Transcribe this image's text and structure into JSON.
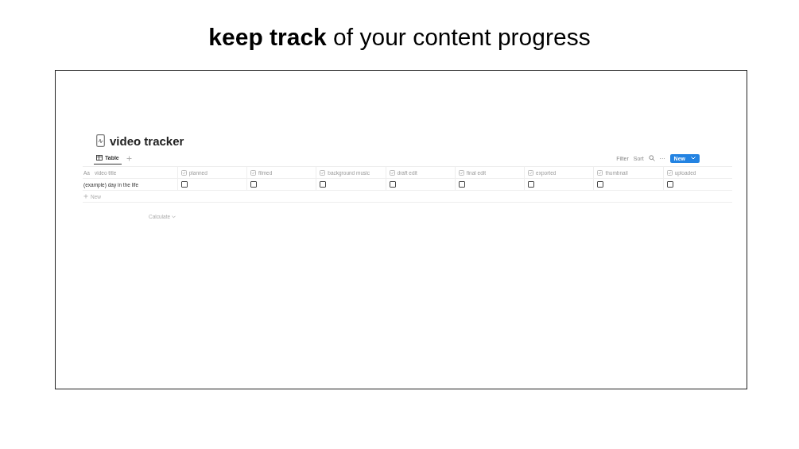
{
  "headline": "**keep track** of your content progress",
  "page": {
    "title": "video tracker"
  },
  "views": [
    {
      "label": "Table",
      "selected": true
    }
  ],
  "toolbar": {
    "filter": "Filter",
    "sort": "Sort",
    "more": "···",
    "new_button": "New"
  },
  "table": {
    "title_column": {
      "icon": "Aa",
      "label": "video title"
    },
    "columns": [
      {
        "label": "planned"
      },
      {
        "label": "filmed"
      },
      {
        "label": "background music"
      },
      {
        "label": "draft edit"
      },
      {
        "label": "final edit"
      },
      {
        "label": "exported"
      },
      {
        "label": "thumbnail"
      },
      {
        "label": "uploaded"
      }
    ],
    "rows": [
      {
        "title": "(example) day in the life",
        "values": [
          false,
          false,
          false,
          false,
          false,
          false,
          false,
          false
        ]
      }
    ],
    "new_row": "New",
    "calculate": "Calculate"
  }
}
